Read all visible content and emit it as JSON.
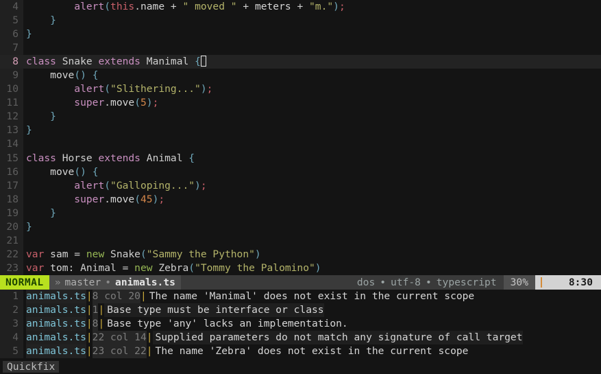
{
  "editor": {
    "filename": "animals.ts",
    "language": "typescript",
    "first_visible_line": 4,
    "lines": [
      {
        "num": 4,
        "cursor": false,
        "tokens": [
          {
            "t": "        ",
            "c": "op"
          },
          {
            "t": "alert",
            "c": "fn"
          },
          {
            "t": "(",
            "c": "punc"
          },
          {
            "t": "this",
            "c": "kwred"
          },
          {
            "t": ".",
            "c": "op"
          },
          {
            "t": "name",
            "c": "id"
          },
          {
            "t": " + ",
            "c": "op"
          },
          {
            "t": "\" moved \"",
            "c": "strq"
          },
          {
            "t": " + ",
            "c": "op"
          },
          {
            "t": "meters",
            "c": "id"
          },
          {
            "t": " + ",
            "c": "op"
          },
          {
            "t": "\"m.\"",
            "c": "strq"
          },
          {
            "t": ")",
            "c": "punc"
          },
          {
            "t": ";",
            "c": "semi"
          }
        ]
      },
      {
        "num": 5,
        "cursor": false,
        "tokens": [
          {
            "t": "    ",
            "c": "op"
          },
          {
            "t": "}",
            "c": "brace"
          }
        ]
      },
      {
        "num": 6,
        "cursor": false,
        "tokens": [
          {
            "t": "}",
            "c": "brace"
          }
        ]
      },
      {
        "num": 7,
        "cursor": false,
        "tokens": []
      },
      {
        "num": 8,
        "cursor": true,
        "tokens": [
          {
            "t": "class",
            "c": "kw"
          },
          {
            "t": " ",
            "c": "op"
          },
          {
            "t": "Snake",
            "c": "type"
          },
          {
            "t": " ",
            "c": "op"
          },
          {
            "t": "extends",
            "c": "kw"
          },
          {
            "t": " ",
            "c": "op"
          },
          {
            "t": "Manimal",
            "c": "type"
          },
          {
            "t": " ",
            "c": "op"
          },
          {
            "t": "{",
            "c": "brace"
          }
        ]
      },
      {
        "num": 9,
        "cursor": false,
        "tokens": [
          {
            "t": "    ",
            "c": "op"
          },
          {
            "t": "move",
            "c": "id"
          },
          {
            "t": "()",
            "c": "punc"
          },
          {
            "t": " ",
            "c": "op"
          },
          {
            "t": "{",
            "c": "brace"
          }
        ]
      },
      {
        "num": 10,
        "cursor": false,
        "tokens": [
          {
            "t": "        ",
            "c": "op"
          },
          {
            "t": "alert",
            "c": "fn"
          },
          {
            "t": "(",
            "c": "punc"
          },
          {
            "t": "\"Slithering...\"",
            "c": "strq"
          },
          {
            "t": ")",
            "c": "punc"
          },
          {
            "t": ";",
            "c": "semi"
          }
        ]
      },
      {
        "num": 11,
        "cursor": false,
        "tokens": [
          {
            "t": "        ",
            "c": "op"
          },
          {
            "t": "super",
            "c": "fn"
          },
          {
            "t": ".",
            "c": "op"
          },
          {
            "t": "move",
            "c": "id"
          },
          {
            "t": "(",
            "c": "punc"
          },
          {
            "t": "5",
            "c": "num"
          },
          {
            "t": ")",
            "c": "punc"
          },
          {
            "t": ";",
            "c": "semi"
          }
        ]
      },
      {
        "num": 12,
        "cursor": false,
        "tokens": [
          {
            "t": "    ",
            "c": "op"
          },
          {
            "t": "}",
            "c": "brace"
          }
        ]
      },
      {
        "num": 13,
        "cursor": false,
        "tokens": [
          {
            "t": "}",
            "c": "brace"
          }
        ]
      },
      {
        "num": 14,
        "cursor": false,
        "tokens": []
      },
      {
        "num": 15,
        "cursor": false,
        "tokens": [
          {
            "t": "class",
            "c": "kw"
          },
          {
            "t": " ",
            "c": "op"
          },
          {
            "t": "Horse",
            "c": "type"
          },
          {
            "t": " ",
            "c": "op"
          },
          {
            "t": "extends",
            "c": "kw"
          },
          {
            "t": " ",
            "c": "op"
          },
          {
            "t": "Animal",
            "c": "type"
          },
          {
            "t": " ",
            "c": "op"
          },
          {
            "t": "{",
            "c": "brace"
          }
        ]
      },
      {
        "num": 16,
        "cursor": false,
        "tokens": [
          {
            "t": "    ",
            "c": "op"
          },
          {
            "t": "move",
            "c": "id"
          },
          {
            "t": "()",
            "c": "punc"
          },
          {
            "t": " ",
            "c": "op"
          },
          {
            "t": "{",
            "c": "brace"
          }
        ]
      },
      {
        "num": 17,
        "cursor": false,
        "tokens": [
          {
            "t": "        ",
            "c": "op"
          },
          {
            "t": "alert",
            "c": "fn"
          },
          {
            "t": "(",
            "c": "punc"
          },
          {
            "t": "\"Galloping...\"",
            "c": "strq"
          },
          {
            "t": ")",
            "c": "punc"
          },
          {
            "t": ";",
            "c": "semi"
          }
        ]
      },
      {
        "num": 18,
        "cursor": false,
        "tokens": [
          {
            "t": "        ",
            "c": "op"
          },
          {
            "t": "super",
            "c": "fn"
          },
          {
            "t": ".",
            "c": "op"
          },
          {
            "t": "move",
            "c": "id"
          },
          {
            "t": "(",
            "c": "punc"
          },
          {
            "t": "45",
            "c": "num"
          },
          {
            "t": ")",
            "c": "punc"
          },
          {
            "t": ";",
            "c": "semi"
          }
        ]
      },
      {
        "num": 19,
        "cursor": false,
        "tokens": [
          {
            "t": "    ",
            "c": "op"
          },
          {
            "t": "}",
            "c": "brace"
          }
        ]
      },
      {
        "num": 20,
        "cursor": false,
        "tokens": [
          {
            "t": "}",
            "c": "brace"
          }
        ]
      },
      {
        "num": 21,
        "cursor": false,
        "tokens": []
      },
      {
        "num": 22,
        "cursor": false,
        "tokens": [
          {
            "t": "var",
            "c": "kwred"
          },
          {
            "t": " ",
            "c": "op"
          },
          {
            "t": "sam",
            "c": "id"
          },
          {
            "t": " = ",
            "c": "op"
          },
          {
            "t": "new",
            "c": "kwgrn"
          },
          {
            "t": " ",
            "c": "op"
          },
          {
            "t": "Snake",
            "c": "type"
          },
          {
            "t": "(",
            "c": "punc"
          },
          {
            "t": "\"Sammy the Python\"",
            "c": "strq"
          },
          {
            "t": ")",
            "c": "punc"
          }
        ]
      },
      {
        "num": 23,
        "cursor": false,
        "tokens": [
          {
            "t": "var",
            "c": "kwred"
          },
          {
            "t": " ",
            "c": "op"
          },
          {
            "t": "tom",
            "c": "id"
          },
          {
            "t": ": ",
            "c": "op"
          },
          {
            "t": "Animal",
            "c": "type"
          },
          {
            "t": " = ",
            "c": "op"
          },
          {
            "t": "new",
            "c": "kwgrn"
          },
          {
            "t": " ",
            "c": "op"
          },
          {
            "t": "Zebra",
            "c": "type"
          },
          {
            "t": "(",
            "c": "punc"
          },
          {
            "t": "\"Tommy the Palomino\"",
            "c": "strq"
          },
          {
            "t": ")",
            "c": "punc"
          }
        ]
      }
    ]
  },
  "statusline": {
    "mode": "NORMAL",
    "branch_icon": "»",
    "branch": "master",
    "modified_dot": "•",
    "filename": "animals.ts",
    "fileformat": "dos",
    "encoding": "utf-8",
    "filetype": "typescript",
    "separator": "•",
    "percent": "30%",
    "position": "8:30",
    "colors": {
      "mode_bg": "#b8e01f",
      "mode_fg": "#1d4500",
      "branch_bg": "#4a4a4a",
      "position_bg": "#d3d3d3",
      "cursor_bar": "#d48c3a"
    }
  },
  "quickfix": {
    "label": "Quickfix",
    "rows": [
      {
        "num": "1",
        "file": "animals.ts",
        "loc": "8 col 20",
        "message": "The name 'Manimal' does not exist in the current scope"
      },
      {
        "num": "2",
        "file": "animals.ts",
        "loc": "1",
        "message": "Base type must be interface or class"
      },
      {
        "num": "3",
        "file": "animals.ts",
        "loc": "8",
        "message": "Base type 'any' lacks an implementation."
      },
      {
        "num": "4",
        "file": "animals.ts",
        "loc": "22 col 14",
        "message": "Supplied parameters do not match any signature of call target"
      },
      {
        "num": "5",
        "file": "animals.ts",
        "loc": "23 col 22",
        "message": "The name 'Zebra' does not exist in the current scope"
      }
    ]
  }
}
